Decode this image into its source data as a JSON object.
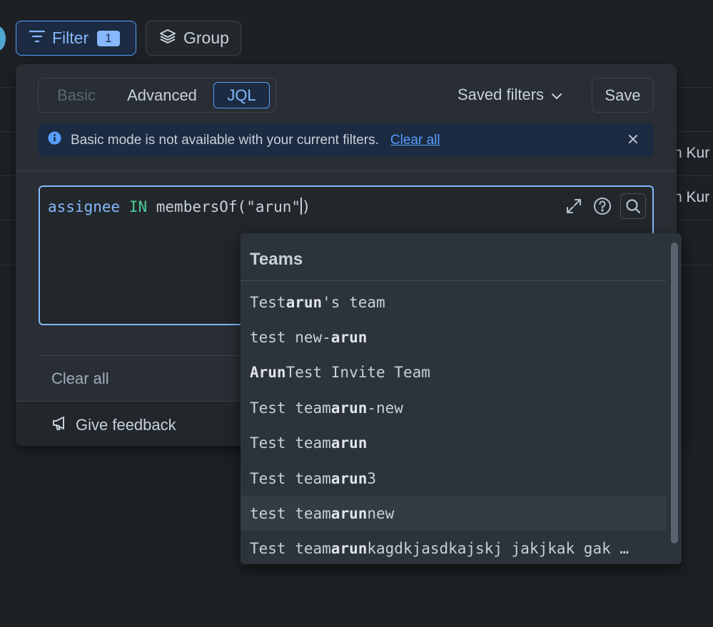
{
  "toolbar": {
    "filter_label": "Filter",
    "filter_count": "1",
    "group_label": "Group"
  },
  "background": {
    "row1_text": "n Kur",
    "row2_text": "n Kur"
  },
  "popup": {
    "tabs": [
      "Basic",
      "Advanced",
      "JQL"
    ],
    "active_tab": "JQL",
    "saved_filters_label": "Saved filters",
    "save_label": "Save",
    "banner": {
      "message": "Basic mode is not available with your current filters.",
      "link": "Clear all"
    },
    "editor": {
      "tok_field": "assignee",
      "tok_op": "IN",
      "tok_func": "membersOf(\"arun\"",
      "tok_close": ")"
    },
    "clear_all_label": "Clear all",
    "feedback_label": "Give feedback"
  },
  "dropdown": {
    "heading": "Teams",
    "items": [
      {
        "pre": "Test ",
        "match": "arun",
        "post": "'s team"
      },
      {
        "pre": "test new-",
        "match": "arun",
        "post": ""
      },
      {
        "pre": "",
        "match": "Arun",
        "post": " Test Invite Team"
      },
      {
        "pre": "Test team ",
        "match": "arun",
        "post": "-new"
      },
      {
        "pre": "Test team ",
        "match": "arun",
        "post": ""
      },
      {
        "pre": "Test team ",
        "match": "arun",
        "post": " 3"
      },
      {
        "pre": "test team ",
        "match": "arun",
        "post": " new"
      },
      {
        "pre": "Test team ",
        "match": "arun",
        "post": " kagdkjasdkajskj jakjkak gak …"
      }
    ],
    "highlighted_index": 6
  }
}
